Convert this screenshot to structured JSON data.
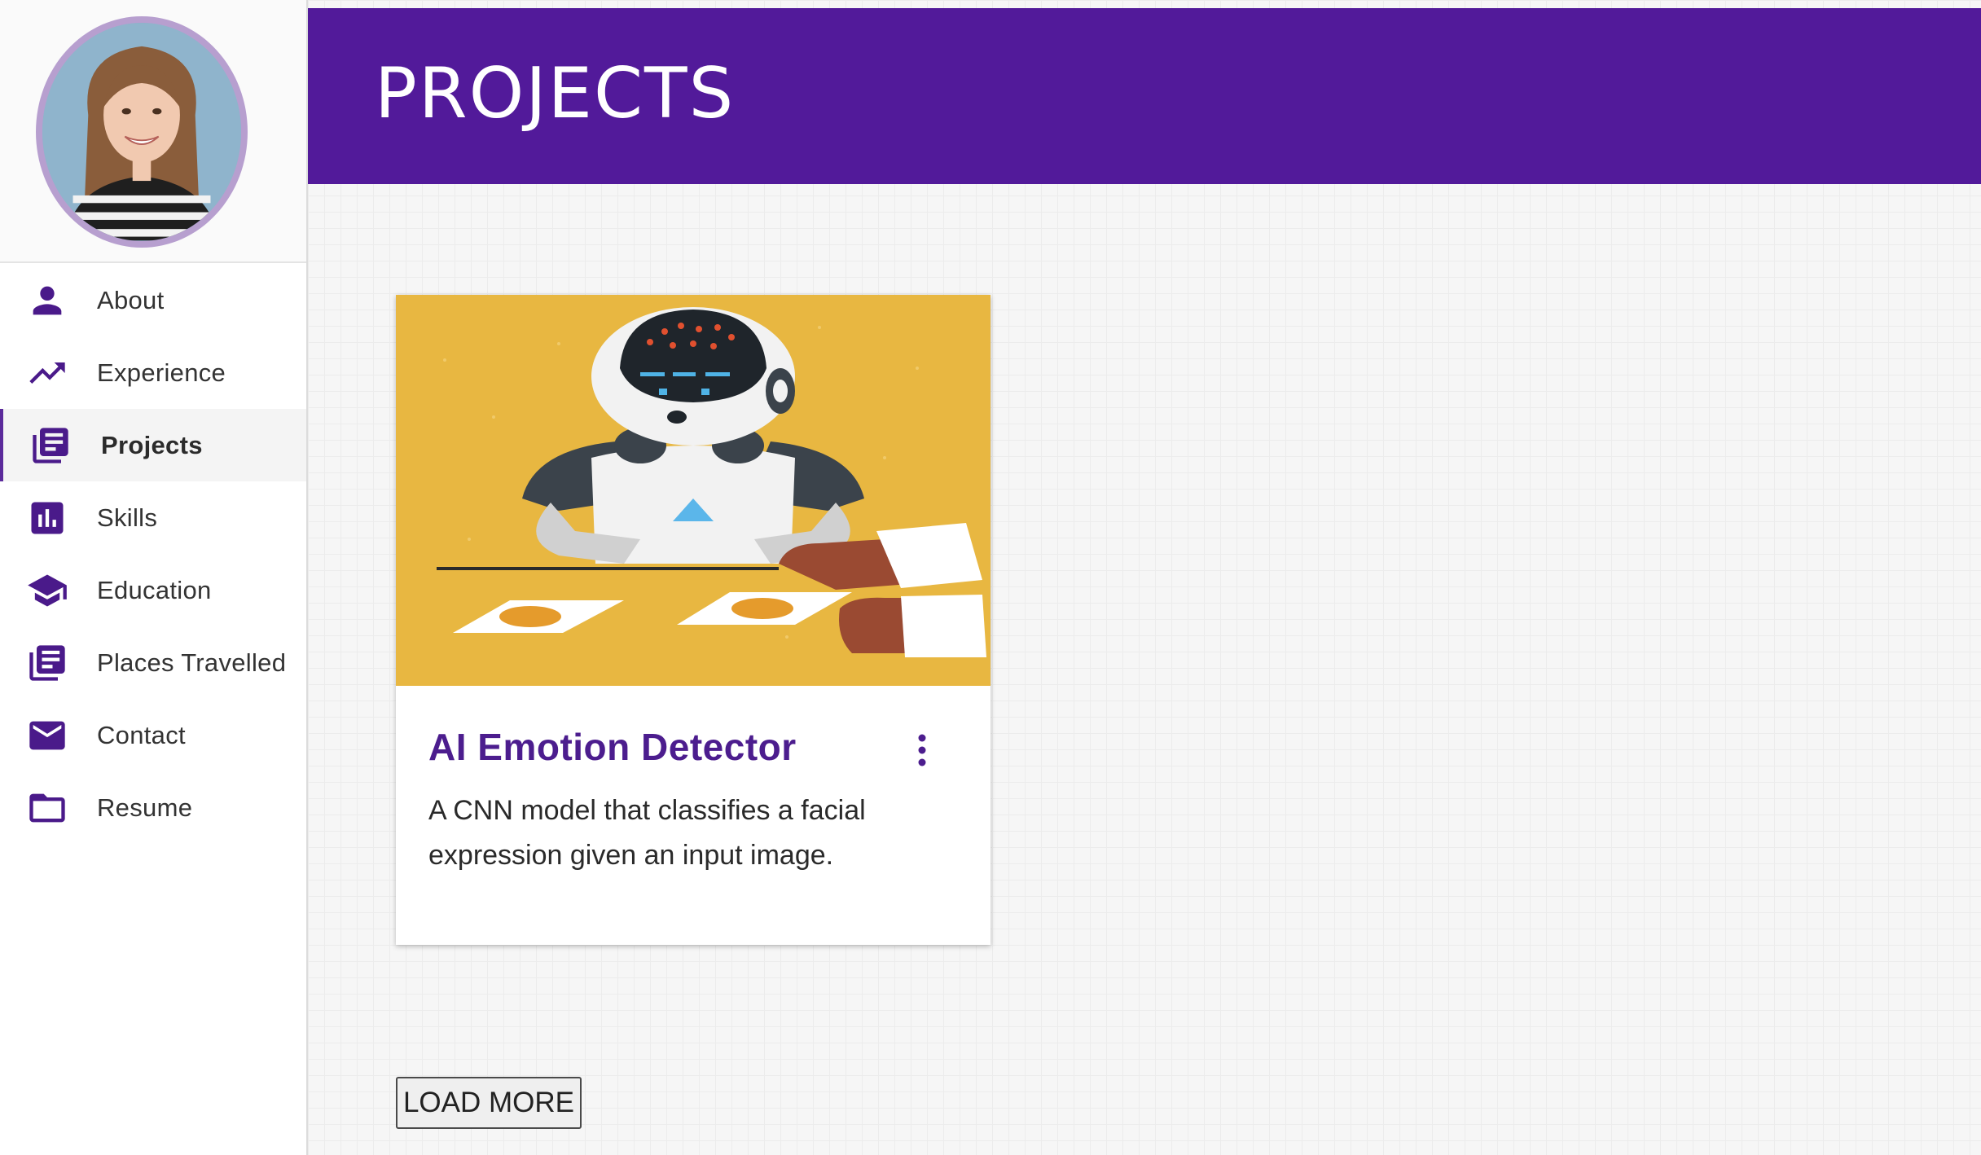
{
  "sidebar": {
    "items": [
      {
        "label": "About",
        "icon": "person-icon"
      },
      {
        "label": "Experience",
        "icon": "trending-up-icon"
      },
      {
        "label": "Projects",
        "icon": "library-books-icon",
        "active": true
      },
      {
        "label": "Skills",
        "icon": "bar-chart-icon"
      },
      {
        "label": "Education",
        "icon": "school-icon"
      },
      {
        "label": "Places Travelled",
        "icon": "library-books-icon"
      },
      {
        "label": "Contact",
        "icon": "mail-icon"
      },
      {
        "label": "Resume",
        "icon": "folder-icon"
      }
    ]
  },
  "header": {
    "title": "PROJECTS"
  },
  "projects": [
    {
      "title": "AI Emotion Detector",
      "description": "A CNN model that classifies a facial expression given an input image."
    }
  ],
  "load_more_label": "LOAD MORE",
  "colors": {
    "brand": "#521a9a",
    "icon": "#4a1a8a",
    "card_title": "#4c1d8e",
    "card_image_bg": "#e8b741"
  }
}
